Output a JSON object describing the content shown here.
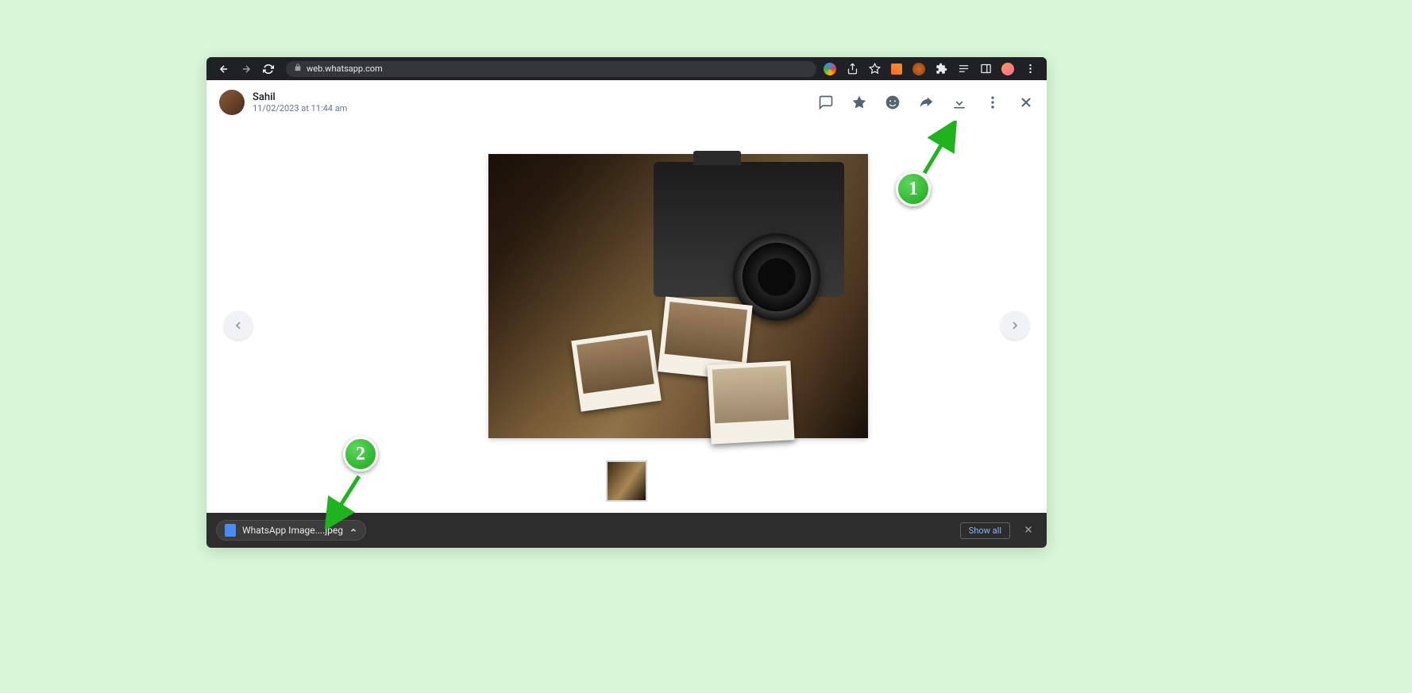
{
  "browser": {
    "url": "web.whatsapp.com"
  },
  "media_viewer": {
    "sender_name": "Sahil",
    "timestamp": "11/02/2023 at 11:44 am"
  },
  "download_bar": {
    "filename": "WhatsApp Image....jpeg",
    "show_all_label": "Show all"
  },
  "annotations": {
    "step1": "1",
    "step2": "2"
  }
}
